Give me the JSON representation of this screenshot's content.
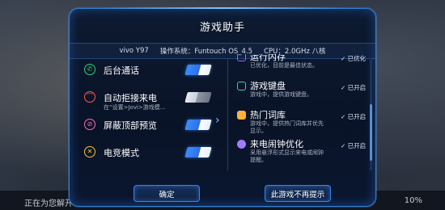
{
  "game": {
    "loading_text": "正在为您解开",
    "loading_percent": "10%"
  },
  "dialog": {
    "title": "游戏助手",
    "device": {
      "model": "vivo Y97",
      "os": "操作系统：Funtouch OS_4.5",
      "cpu": "CPU：2.0GHz 八核"
    },
    "left_items": [
      {
        "label": "后台通话",
        "sub": "",
        "icon": "phone-icon",
        "toggle": "on"
      },
      {
        "label": "自动拒接来电",
        "sub": "在“设置>Jovi>游戏模…",
        "icon": "phone-reject-icon",
        "toggle": "off"
      },
      {
        "label": "屏蔽顶部预览",
        "sub": "",
        "icon": "block-icon",
        "toggle": "on"
      },
      {
        "label": "电竞模式",
        "sub": "",
        "icon": "esports-icon",
        "toggle": "on"
      }
    ],
    "right_items": [
      {
        "name": "运行内存",
        "desc": "已优化，目前是最佳状态。",
        "status": "✓ 已优化",
        "icon": "memory-icon",
        "color": "#9b6bff"
      },
      {
        "name": "游戏键盘",
        "desc": "游戏中，提供游戏键盘。",
        "status": "✓ 已开启",
        "icon": "keyboard-icon",
        "color": "#3fd0a0"
      },
      {
        "name": "热门词库",
        "desc": "游戏中，提供热门词库并优先显示。",
        "status": "✓ 已开启",
        "icon": "wordbank-icon",
        "color": "#ffb23a"
      },
      {
        "name": "来电闹钟优化",
        "desc": "采用悬浮形式显示来电或闹钟提醒。",
        "status": "✓ 已开启",
        "icon": "alarm-icon",
        "color": "#a07bff"
      }
    ],
    "buttons": {
      "ok": "确定",
      "never": "此游戏不再提示"
    },
    "colors": {
      "accent": "#2f7fd6",
      "toggle_on": "#3a8cff"
    }
  }
}
